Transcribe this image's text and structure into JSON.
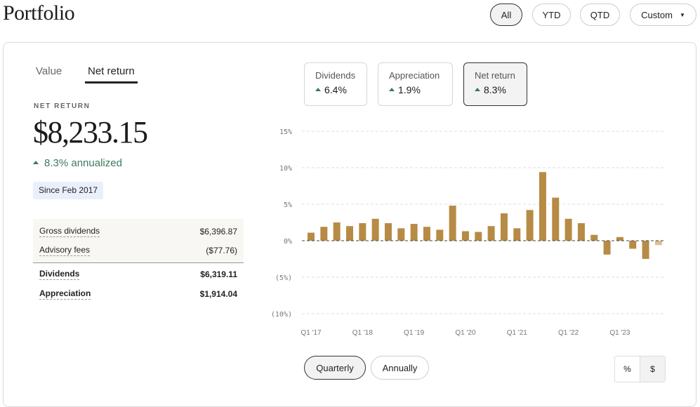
{
  "header": {
    "title": "Portfolio",
    "ranges": [
      {
        "label": "All",
        "active": true
      },
      {
        "label": "YTD"
      },
      {
        "label": "QTD"
      },
      {
        "label": "Custom"
      }
    ]
  },
  "tabs": [
    {
      "label": "Value"
    },
    {
      "label": "Net return",
      "active": true
    }
  ],
  "summary": {
    "label": "NET RETURN",
    "amount": "$8,233.15",
    "annualized": "8.3% annualized",
    "since": "Since Feb 2017"
  },
  "breakdown": [
    {
      "label": "Gross dividends",
      "value": "$6,396.87"
    },
    {
      "label": "Advisory fees",
      "value": "($77.76)"
    },
    {
      "label": "Dividends",
      "value": "$6,319.11"
    },
    {
      "label": "Appreciation",
      "value": "$1,914.04"
    }
  ],
  "cards": [
    {
      "name": "Dividends",
      "value": "6.4%"
    },
    {
      "name": "Appreciation",
      "value": "1.9%"
    },
    {
      "name": "Net return",
      "value": "8.3%",
      "active": true
    }
  ],
  "chart_data": {
    "type": "bar",
    "categories": [
      "Q1 '17",
      "Q2 '17",
      "Q3 '17",
      "Q4 '17",
      "Q1 '18",
      "Q2 '18",
      "Q3 '18",
      "Q4 '18",
      "Q1 '19",
      "Q2 '19",
      "Q3 '19",
      "Q4 '19",
      "Q1 '20",
      "Q2 '20",
      "Q3 '20",
      "Q4 '20",
      "Q1 '21",
      "Q2 '21",
      "Q3 '21",
      "Q4 '21",
      "Q1 '22",
      "Q2 '22",
      "Q3 '22",
      "Q4 '22",
      "Q1 '23",
      "Q2 '23",
      "Q3 '23",
      "Q4 '23"
    ],
    "values": [
      1.1,
      1.9,
      2.5,
      2.0,
      2.4,
      3.0,
      2.4,
      1.7,
      2.3,
      1.9,
      1.5,
      4.8,
      1.3,
      1.2,
      2.0,
      3.75,
      1.7,
      4.2,
      9.4,
      5.9,
      3.0,
      2.4,
      0.8,
      -1.9,
      0.5,
      -1.1,
      -2.5,
      -0.6
    ],
    "xtick_labels": [
      "Q1 '17",
      "Q1 '18",
      "Q1 '19",
      "Q1 '20",
      "Q1 '21",
      "Q1 '22",
      "Q1 '23"
    ],
    "ytick_labels": [
      "15%",
      "10%",
      "5%",
      "0%",
      "(5%)",
      "(10%)"
    ],
    "yticks": [
      15,
      10,
      5,
      0,
      -5,
      -10
    ],
    "ylim": [
      -10,
      15
    ],
    "grid": true,
    "bar_color": "#b78b45",
    "last_bar_color": "#d9bf95"
  },
  "controls": {
    "periods": [
      {
        "label": "Quarterly",
        "active": true
      },
      {
        "label": "Annually"
      }
    ],
    "units": [
      {
        "label": "%",
        "active": true
      },
      {
        "label": "$"
      }
    ]
  }
}
